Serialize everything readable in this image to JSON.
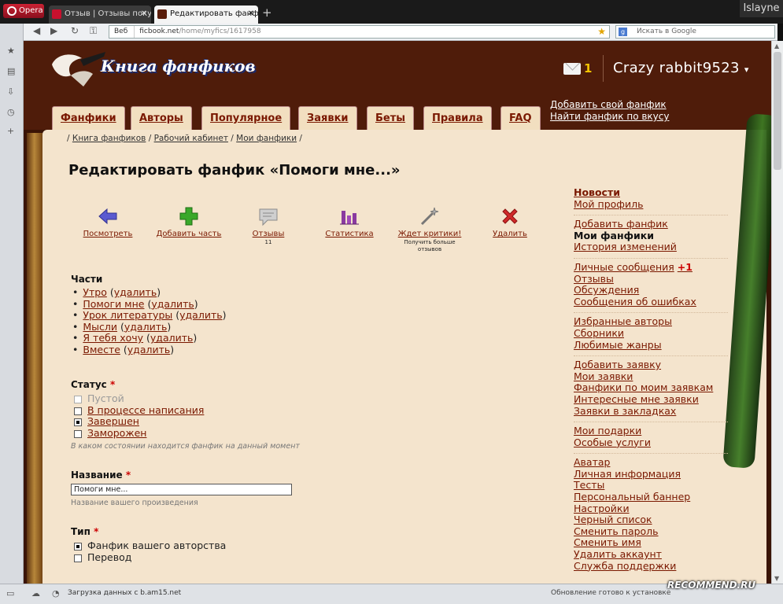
{
  "browser": {
    "opera_label": "Opera",
    "tabs": [
      {
        "title": "Отзыв | Отзывы покуп..."
      },
      {
        "title": "Редактировать фанфи..."
      }
    ],
    "new_tab": "+",
    "os_user": "Islayne",
    "web_label": "Веб",
    "url_domain": "ficbook.net",
    "url_path": "/home/myfics/1617958",
    "search_placeholder": "Искать в Google",
    "status_left": "Загрузка данных с b.am15.net",
    "status_right": "Обновление готово к установке"
  },
  "header": {
    "logo_text": "Книга фанфиков",
    "mail_count": "1",
    "username": "Crazy rabbit9523",
    "caret": "▾",
    "nav_tabs": [
      "Фанфики",
      "Авторы",
      "Популярное",
      "Заявки",
      "Беты",
      "Правила",
      "FAQ"
    ],
    "links": [
      "Добавить свой фанфик",
      "Найти фанфик по вкусу"
    ]
  },
  "breadcrumb": [
    "Книга фанфиков",
    "Рабочий кабинет",
    "Мои фанфики"
  ],
  "page_title": "Редактировать фанфик «Помоги мне...»",
  "toolbar": [
    {
      "label": "Посмотреть",
      "icon": "arrow-left-icon",
      "color": "#5a5ad0"
    },
    {
      "label": "Добавить часть",
      "icon": "plus-icon",
      "color": "#3aa82a"
    },
    {
      "label": "Отзывы",
      "icon": "comment-icon",
      "count": "11",
      "color": "#9a9a9a"
    },
    {
      "label": "Статистика",
      "icon": "bar-chart-icon",
      "color": "#8a3aa0"
    },
    {
      "label": "Ждет критики!",
      "icon": "wand-icon",
      "sub": "Получить больше отзывов",
      "color": "#888888"
    },
    {
      "label": "Удалить",
      "icon": "delete-x-icon",
      "color": "#d02a2a"
    }
  ],
  "parts": {
    "heading": "Части",
    "delete_label": "удалить",
    "items": [
      "Утро",
      "Помоги мне",
      "Урок литературы",
      "Мысли",
      "Я тебя хочу",
      "Вместе"
    ]
  },
  "status": {
    "heading": "Статус",
    "options": [
      "Пустой",
      "В процессе написания",
      "Завершен",
      "Заморожен"
    ],
    "selected": "Завершен",
    "hint": "В каком состоянии находится фанфик на данный момент"
  },
  "title_field": {
    "heading": "Название",
    "value": "Помоги мне...",
    "hint": "Название вашего произведения"
  },
  "type_field": {
    "heading": "Тип",
    "options": [
      "Фанфик вашего авторства",
      "Перевод"
    ],
    "selected": "Фанфик вашего авторства"
  },
  "required_mark": "*",
  "sidebar": [
    [
      "Новости",
      "Мой профиль"
    ],
    [
      "Добавить фанфик",
      "Мои фанфики",
      "История изменений"
    ],
    [
      "Личные сообщения",
      "Отзывы",
      "Обсуждения",
      "Сообщения об ошибках"
    ],
    [
      "Избранные авторы",
      "Сборники",
      "Любимые жанры"
    ],
    [
      "Добавить заявку",
      "Мои заявки",
      "Фанфики по моим заявкам",
      "Интересные мне заявки",
      "Заявки в закладках"
    ],
    [
      "Мои подарки",
      "Особые услуги"
    ],
    [
      "Аватар",
      "Личная информация",
      "Тесты",
      "Персональный баннер",
      "Настройки",
      "Черный список",
      "Сменить пароль",
      "Сменить имя",
      "Удалить аккаунт",
      "Служба поддержки"
    ]
  ],
  "sidebar_active": "Мои фанфики",
  "sidebar_bold": "Новости",
  "pm_badge": "+1",
  "watermark": "RECOMMEND.RU"
}
